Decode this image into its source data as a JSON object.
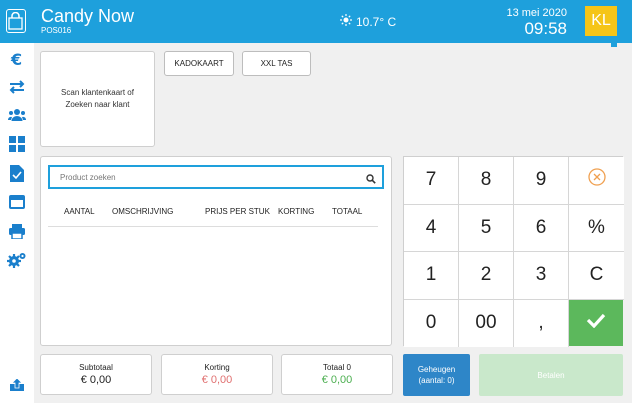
{
  "header": {
    "title": "Candy Now",
    "pos_id": "POS016",
    "temperature": "10.7° C",
    "date": "13 mei 2020",
    "time": "09:58",
    "user_initials": "KL"
  },
  "sidebar": {
    "icons": [
      "euro-icon",
      "exchange-arrows-icon",
      "customers-icon",
      "grid-icon",
      "document-check-icon",
      "card-icon",
      "printer-icon",
      "settings-gears-icon",
      "upload-icon"
    ]
  },
  "customer": {
    "scan_text": "Scan klantenkaart of Zoeken naar klant"
  },
  "quick_buttons": {
    "gift_card": "KADOKAART",
    "bag": "XXL TAS"
  },
  "search": {
    "placeholder": "Product zoeken"
  },
  "table": {
    "columns": [
      "AANTAL",
      "OMSCHRIJVING",
      "PRIJS PER STUK",
      "KORTING",
      "TOTAAL"
    ],
    "rows": []
  },
  "keypad": {
    "row1": [
      "7",
      "8",
      "9"
    ],
    "row2": [
      "4",
      "5",
      "6",
      "%"
    ],
    "row3": [
      "1",
      "2",
      "3",
      "C"
    ],
    "row4": [
      "0",
      "00",
      ","
    ]
  },
  "totals": {
    "subtotal_label": "Subtotaal",
    "subtotal_value": "€ 0,00",
    "discount_label": "Korting",
    "discount_value": "€ 0,00",
    "total_label": "Totaal 0",
    "total_value": "€ 0,00"
  },
  "actions": {
    "memory_line1": "Geheugen",
    "memory_line2": "(aantal: 0)",
    "pay": "Betalen"
  },
  "colors": {
    "header": "#1ea0dc",
    "accent_blue": "#1a7fcc",
    "confirm_green": "#5cb85c",
    "pay_disabled": "#c9e8cb",
    "discount_red": "#e07070",
    "total_green": "#4caf50",
    "avatar_yellow": "#f5c518"
  }
}
